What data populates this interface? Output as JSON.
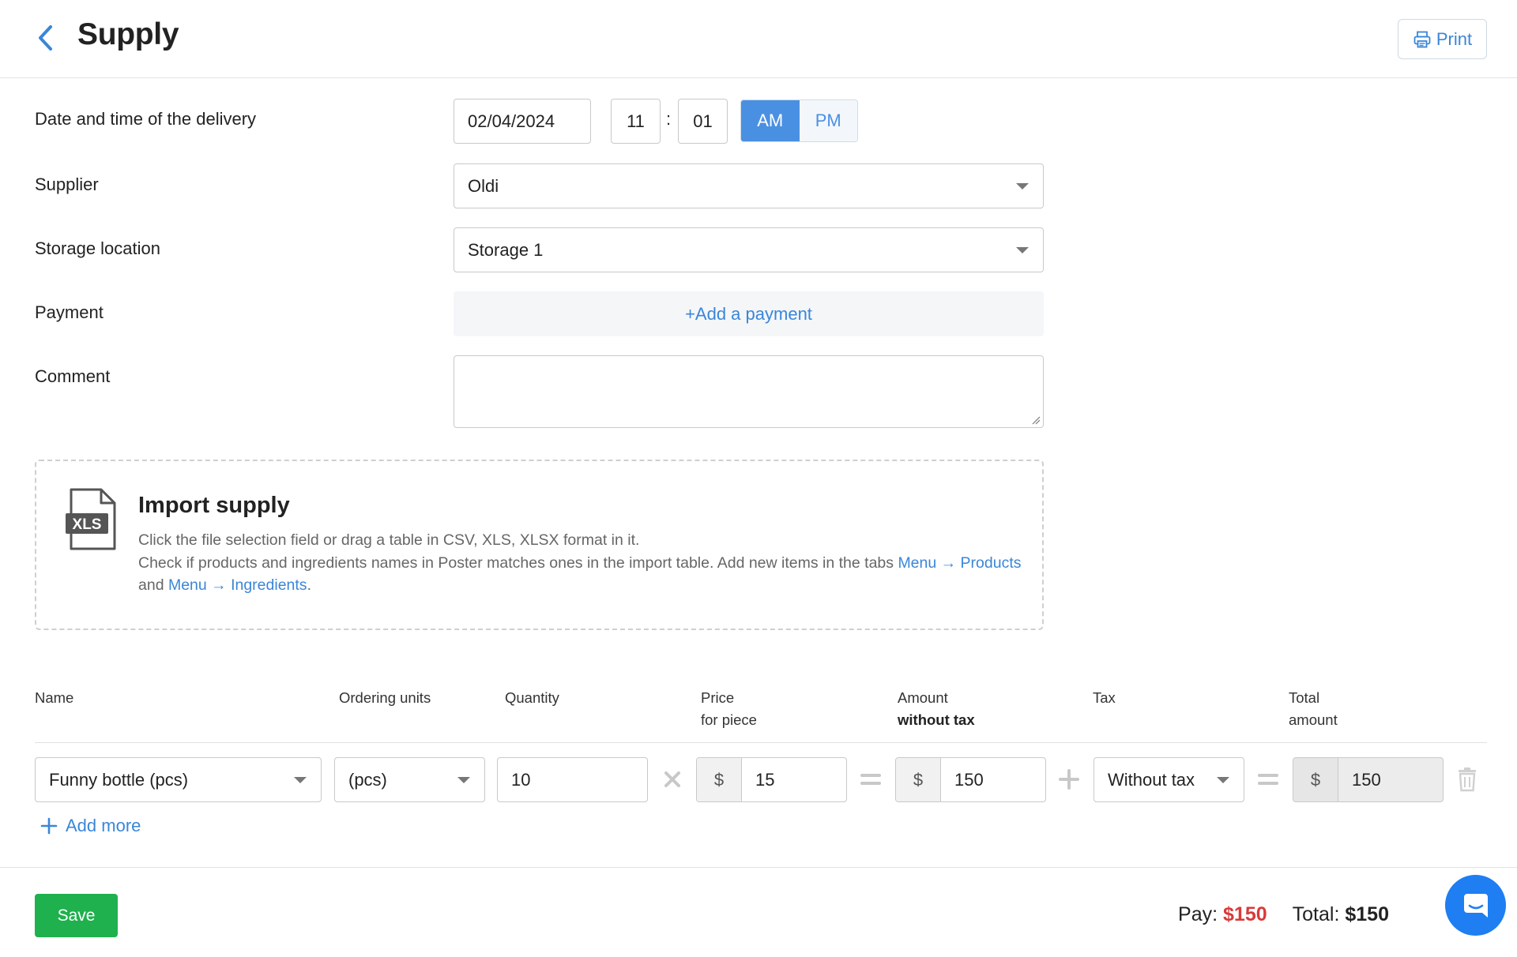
{
  "header": {
    "title": "Supply",
    "print_label": "Print"
  },
  "form": {
    "date_label": "Date and time of the delivery",
    "date_value": "02/04/2024",
    "hour_value": "11",
    "time_separator": ":",
    "minute_value": "01",
    "am_label": "AM",
    "pm_label": "PM",
    "selected_period": "AM",
    "supplier_label": "Supplier",
    "supplier_value": "Oldi",
    "storage_label": "Storage location",
    "storage_value": "Storage 1",
    "payment_label": "Payment",
    "add_payment_label": "+Add a payment",
    "comment_label": "Comment",
    "comment_value": ""
  },
  "import": {
    "icon_label": "XLS",
    "title": "Import supply",
    "line1": "Click the file selection field or drag a table in CSV, XLS, XLSX format in it.",
    "line2": "Check if products and ingredients names in Poster matches ones in the import table. Add new items in the tabs ",
    "link1": "Menu → Products",
    "and": " and ",
    "link2": "Menu → Ingredients",
    "period": "."
  },
  "table": {
    "headers": {
      "name": "Name",
      "ordering_units": "Ordering units",
      "quantity": "Quantity",
      "price_line1": "Price",
      "price_line2": "for piece",
      "amount_line1": "Amount",
      "amount_line2": "without tax",
      "tax": "Tax",
      "total_line1": "Total",
      "total_line2": "amount"
    },
    "rows": [
      {
        "name": "Funny bottle (pcs)",
        "units": "(pcs)",
        "quantity": "10",
        "currency": "$",
        "price": "15",
        "amount": "150",
        "tax": "Without tax",
        "total": "150"
      }
    ],
    "add_more_label": "Add more"
  },
  "footer": {
    "save_label": "Save",
    "pay_label": "Pay:",
    "pay_amount": "$150",
    "total_label": "Total:",
    "total_amount": "$150"
  },
  "colors": {
    "accent": "#4a90e2",
    "link": "#3a86d8",
    "save": "#1fb14d",
    "pay_amount": "#d83a3a",
    "chat": "#1e7ef2"
  },
  "icons": [
    "back-chevron-icon",
    "printer-icon",
    "xls-file-icon",
    "times-icon",
    "equals-icon",
    "plus-icon",
    "trash-icon",
    "chat-icon"
  ]
}
